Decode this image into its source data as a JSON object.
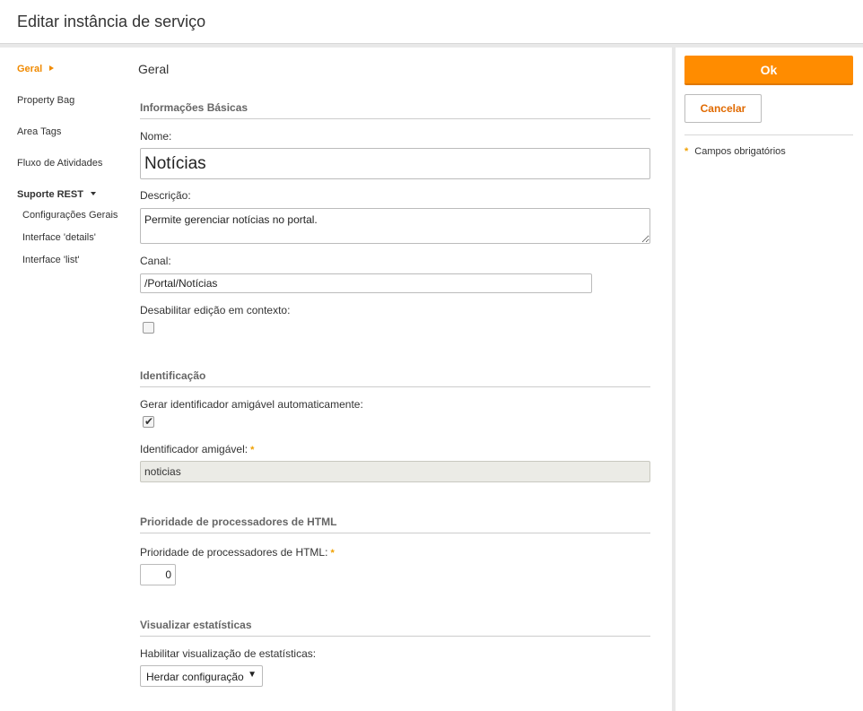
{
  "window": {
    "title": "Editar instância de serviço"
  },
  "sidebar": {
    "items": [
      {
        "label": "Geral"
      },
      {
        "label": "Property Bag"
      },
      {
        "label": "Area Tags"
      },
      {
        "label": "Fluxo de Atividades"
      },
      {
        "label": "Suporte REST"
      }
    ],
    "subitems": [
      {
        "label": "Configurações Gerais"
      },
      {
        "label": "Interface 'details'"
      },
      {
        "label": "Interface 'list'"
      }
    ]
  },
  "main": {
    "heading": "Geral",
    "basic": {
      "section_title": "Informações Básicas",
      "name_label": "Nome:",
      "name_value": "Notícias",
      "description_label": "Descrição:",
      "description_value": "Permite gerenciar notícias no portal.",
      "channel_label": "Canal:",
      "channel_value": "/Portal/Notícias",
      "disable_edit_label": "Desabilitar edição em contexto:",
      "disable_edit_checked": false
    },
    "identification": {
      "section_title": "Identificação",
      "auto_id_label": "Gerar identificador amigável automaticamente:",
      "auto_id_checked": true,
      "friendly_id_label": "Identificador amigável:",
      "friendly_id_value": "noticias"
    },
    "html_processors": {
      "section_title": "Prioridade de processadores de HTML",
      "priority_label": "Prioridade de processadores de HTML:",
      "priority_value": "0"
    },
    "stats": {
      "section_title": "Visualizar estatísticas",
      "enable_label": "Habilitar visualização de estatísticas:",
      "selected_option": "Herdar configuração"
    }
  },
  "actions": {
    "ok_label": "Ok",
    "cancel_label": "Cancelar",
    "required_legend": "Campos obrigatórios",
    "required_marker": "*"
  },
  "colors": {
    "accent": "#ff8c00",
    "active_nav": "#f08a00",
    "required": "#f0a000"
  }
}
